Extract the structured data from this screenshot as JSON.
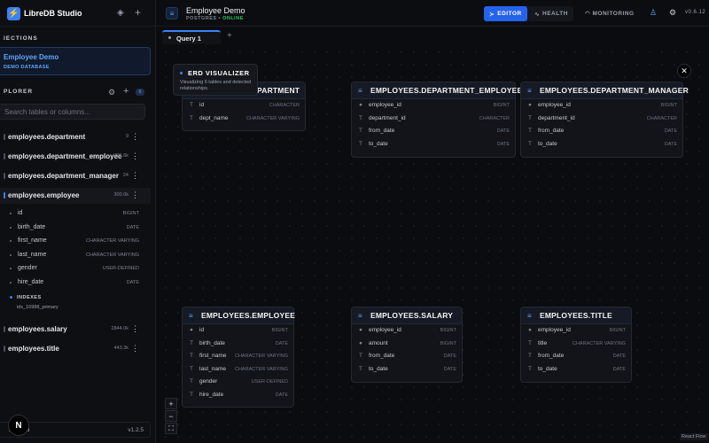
{
  "app": {
    "title": "LibreDB Studio",
    "logo_icon": "bolt-icon"
  },
  "sidebar": {
    "connections_label": "IECTIONS",
    "connection": {
      "name": "Employee Demo",
      "subtitle": "DEMO DATABASE"
    },
    "explorer_label": "PLORER",
    "table_count": "6",
    "search_placeholder": "Search tables or columns...",
    "tables": [
      {
        "name": "employees.department",
        "count": "9"
      },
      {
        "name": "employees.department_employee",
        "count": "331.6k"
      },
      {
        "name": "employees.department_manager",
        "count": "24"
      },
      {
        "name": "employees.employee",
        "count": "300.0k"
      },
      {
        "name": "employees.salary",
        "count": "2844.0k"
      },
      {
        "name": "employees.title",
        "count": "443.3k"
      }
    ],
    "expanded_columns": [
      {
        "name": "id",
        "type": "BIGINT"
      },
      {
        "name": "birth_date",
        "type": "DATE"
      },
      {
        "name": "first_name",
        "type": "CHARACTER VARYING"
      },
      {
        "name": "last_name",
        "type": "CHARACTER VARYING"
      },
      {
        "name": "gender",
        "type": "USER-DEFINED"
      },
      {
        "name": "hire_date",
        "type": "DATE"
      }
    ],
    "indexes_label": "INDEXES",
    "index_name": "idx_16988_primary",
    "footer_status": "nnected",
    "footer_version": "v1.2.5",
    "n_badge": "N"
  },
  "header": {
    "db_title": "Employee Demo",
    "db_engine": "POSTGRES",
    "db_sep": "•",
    "db_status": "ONLINE",
    "editor_label": "EDITOR",
    "health_label": "HEALTH",
    "monitoring_label": "MONITORING",
    "version": "v0.6.12"
  },
  "tabs": {
    "query_tab": "Query 1"
  },
  "erd": {
    "tip_title": "ERD VISUALIZER",
    "tip_desc": "Visualizing 6 tables and detected relationships.",
    "react_flow": "React Flow",
    "nodes": [
      {
        "title": "EMPLOYEES.DEPARTMENT",
        "visible_title": "PARTMENT",
        "cols": [
          {
            "icon": "T",
            "name": "id",
            "type": "CHARACTER"
          },
          {
            "icon": "T",
            "name": "dept_name",
            "type": "CHARACTER VARYING"
          }
        ]
      },
      {
        "title": "EMPLOYEES.DEPARTMENT_EMPLOYEE",
        "cols": [
          {
            "icon": "●",
            "name": "employee_id",
            "type": "BIGINT"
          },
          {
            "icon": "T",
            "name": "department_id",
            "type": "CHARACTER"
          },
          {
            "icon": "T",
            "name": "from_date",
            "type": "DATE"
          },
          {
            "icon": "T",
            "name": "to_date",
            "type": "DATE"
          }
        ]
      },
      {
        "title": "EMPLOYEES.DEPARTMENT_MANAGER",
        "cols": [
          {
            "icon": "●",
            "name": "employee_id",
            "type": "BIGINT"
          },
          {
            "icon": "T",
            "name": "department_id",
            "type": "CHARACTER"
          },
          {
            "icon": "T",
            "name": "from_date",
            "type": "DATE"
          },
          {
            "icon": "T",
            "name": "to_date",
            "type": "DATE"
          }
        ]
      },
      {
        "title": "EMPLOYEES.EMPLOYEE",
        "cols": [
          {
            "icon": "●",
            "name": "id",
            "type": "BIGINT"
          },
          {
            "icon": "T",
            "name": "birth_date",
            "type": "DATE"
          },
          {
            "icon": "T",
            "name": "first_name",
            "type": "CHARACTER VARYING"
          },
          {
            "icon": "T",
            "name": "last_name",
            "type": "CHARACTER VARYING"
          },
          {
            "icon": "T",
            "name": "gender",
            "type": "USER-DEFINED"
          },
          {
            "icon": "T",
            "name": "hire_date",
            "type": "DATE"
          }
        ]
      },
      {
        "title": "EMPLOYEES.SALARY",
        "cols": [
          {
            "icon": "●",
            "name": "employee_id",
            "type": "BIGINT"
          },
          {
            "icon": "●",
            "name": "amount",
            "type": "BIGINT"
          },
          {
            "icon": "T",
            "name": "from_date",
            "type": "DATE"
          },
          {
            "icon": "T",
            "name": "to_date",
            "type": "DATE"
          }
        ]
      },
      {
        "title": "EMPLOYEES.TITLE",
        "cols": [
          {
            "icon": "●",
            "name": "employee_id",
            "type": "BIGINT"
          },
          {
            "icon": "T",
            "name": "title",
            "type": "CHARACTER VARYING"
          },
          {
            "icon": "T",
            "name": "from_date",
            "type": "DATE"
          },
          {
            "icon": "T",
            "name": "to_date",
            "type": "DATE"
          }
        ]
      }
    ]
  },
  "colors": {
    "accent": "#3b82f6",
    "online": "#22c55e",
    "bg": "#0b0c10"
  }
}
